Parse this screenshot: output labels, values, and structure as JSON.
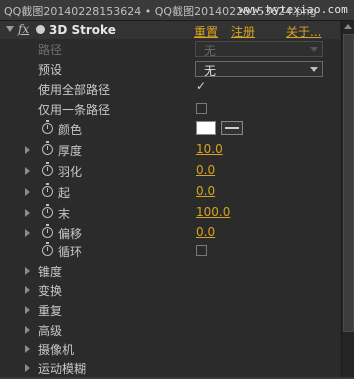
{
  "window": {
    "title": "QQ截图20140228153624 • QQ截图20140228153624.png",
    "watermark": "www.hytexiao.com"
  },
  "effect": {
    "fx_icon": "fx",
    "name": "3D Stroke",
    "reset_label": "重置",
    "register_label": "注册",
    "about_label": "关于..."
  },
  "properties": {
    "path": {
      "label": "路径",
      "value": "无"
    },
    "preset": {
      "label": "预设",
      "value": "无"
    },
    "use_all_paths": {
      "label": "使用全部路径",
      "checked": true,
      "check_glyph": "✓"
    },
    "single_path": {
      "label": "仅用一条路径",
      "checked": false
    },
    "color": {
      "label": "颜色",
      "value": "#ffffff"
    },
    "thickness": {
      "label": "厚度",
      "value": "10.0"
    },
    "feather": {
      "label": "羽化",
      "value": "0.0"
    },
    "start": {
      "label": "起",
      "value": "0.0"
    },
    "end": {
      "label": "末",
      "value": "100.0"
    },
    "offset": {
      "label": "偏移",
      "value": "0.0"
    },
    "loop": {
      "label": "循环",
      "checked": false
    }
  },
  "groups": [
    {
      "label": "锥度"
    },
    {
      "label": "变换"
    },
    {
      "label": "重复"
    },
    {
      "label": "高级"
    },
    {
      "label": "摄像机"
    },
    {
      "label": "运动模糊"
    }
  ],
  "colors": {
    "accent": "#d8a320",
    "background": "#2b2b2b"
  }
}
